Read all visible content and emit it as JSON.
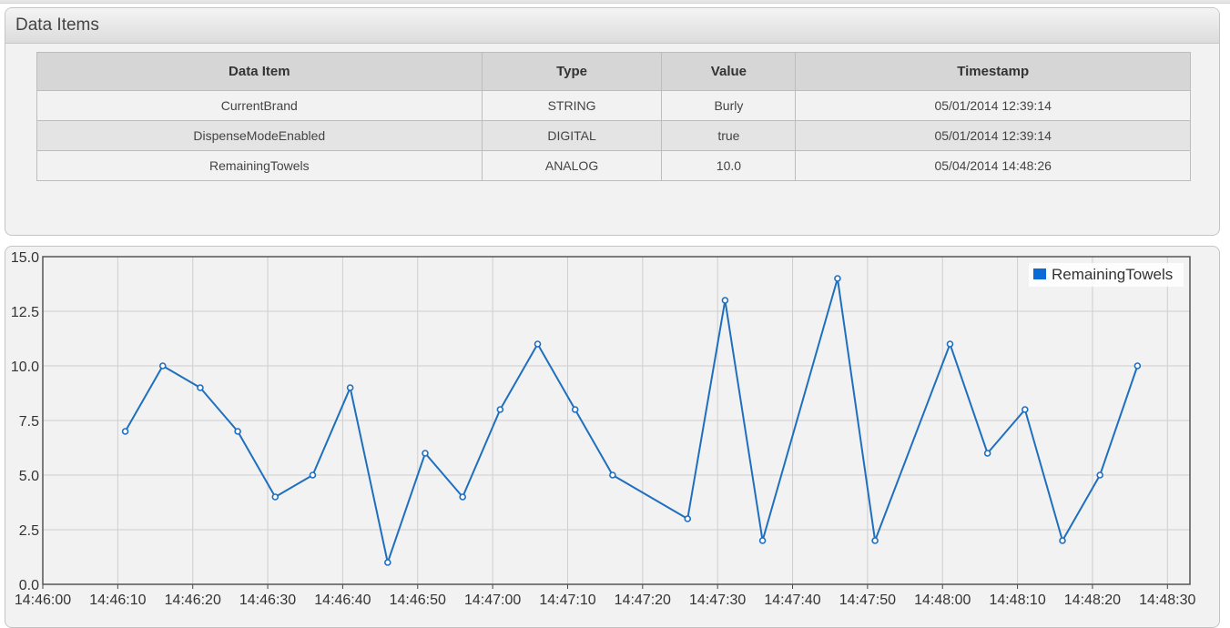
{
  "panel": {
    "title": "Data Items"
  },
  "table": {
    "headers": [
      "Data Item",
      "Type",
      "Value",
      "Timestamp"
    ],
    "rows": [
      [
        "CurrentBrand",
        "STRING",
        "Burly",
        "05/01/2014 12:39:14"
      ],
      [
        "DispenseModeEnabled",
        "DIGITAL",
        "true",
        "05/01/2014 12:39:14"
      ],
      [
        "RemainingTowels",
        "ANALOG",
        "10.0",
        "05/04/2014 14:48:26"
      ]
    ]
  },
  "colors": {
    "series": "#1f6fbf",
    "accent": "#0a6ad6"
  },
  "chart_data": {
    "type": "line",
    "series": [
      {
        "name": "RemainingTowels",
        "x": [
          "14:46:11",
          "14:46:16",
          "14:46:21",
          "14:46:26",
          "14:46:31",
          "14:46:36",
          "14:46:41",
          "14:46:46",
          "14:46:51",
          "14:46:56",
          "14:47:01",
          "14:47:06",
          "14:47:11",
          "14:47:16",
          "14:47:26",
          "14:47:31",
          "14:47:36",
          "14:47:46",
          "14:47:51",
          "14:48:01",
          "14:48:06",
          "14:48:11",
          "14:48:16",
          "14:48:21",
          "14:48:26"
        ],
        "values": [
          7,
          10,
          9,
          7,
          4,
          5,
          9,
          1,
          6,
          4,
          8,
          11,
          8,
          5,
          3,
          13,
          2,
          14,
          2,
          11,
          6,
          8,
          2,
          5,
          10
        ]
      }
    ],
    "xticks": [
      "14:46:00",
      "14:46:10",
      "14:46:20",
      "14:46:30",
      "14:46:40",
      "14:46:50",
      "14:47:00",
      "14:47:10",
      "14:47:20",
      "14:47:30",
      "14:47:40",
      "14:47:50",
      "14:48:00",
      "14:48:10",
      "14:48:20",
      "14:48:30"
    ],
    "yticks": [
      "0.0",
      "2.5",
      "5.0",
      "7.5",
      "10.0",
      "12.5",
      "15.0"
    ],
    "ylim": [
      0,
      15
    ],
    "xlim": [
      "14:46:00",
      "14:48:33"
    ],
    "grid": true,
    "legend": "top-right"
  }
}
